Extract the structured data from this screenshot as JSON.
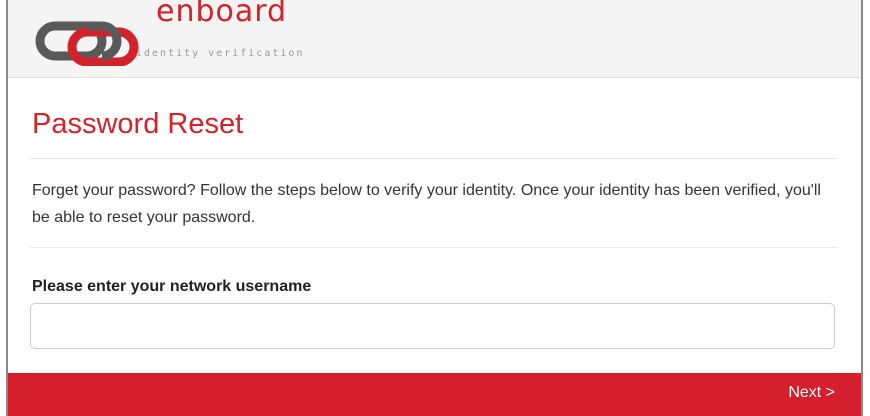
{
  "header": {
    "brand_name": "enboard",
    "tagline": "identity verification",
    "logo_icon": "linked-rings-logo-icon"
  },
  "main": {
    "title": "Password Reset",
    "description": "Forget your password? Follow the steps below to verify your identity. Once your identity has been verified, you'll be able to reset your password.",
    "username_label": "Please enter your network username",
    "username_value": "",
    "username_placeholder": ""
  },
  "footer": {
    "next_label": "Next >"
  },
  "colors": {
    "brand_red": "#d2232a",
    "bar_red": "#d61f2c",
    "logo_gray": "#5a5a5a",
    "header_bg": "#f4f4f4"
  }
}
